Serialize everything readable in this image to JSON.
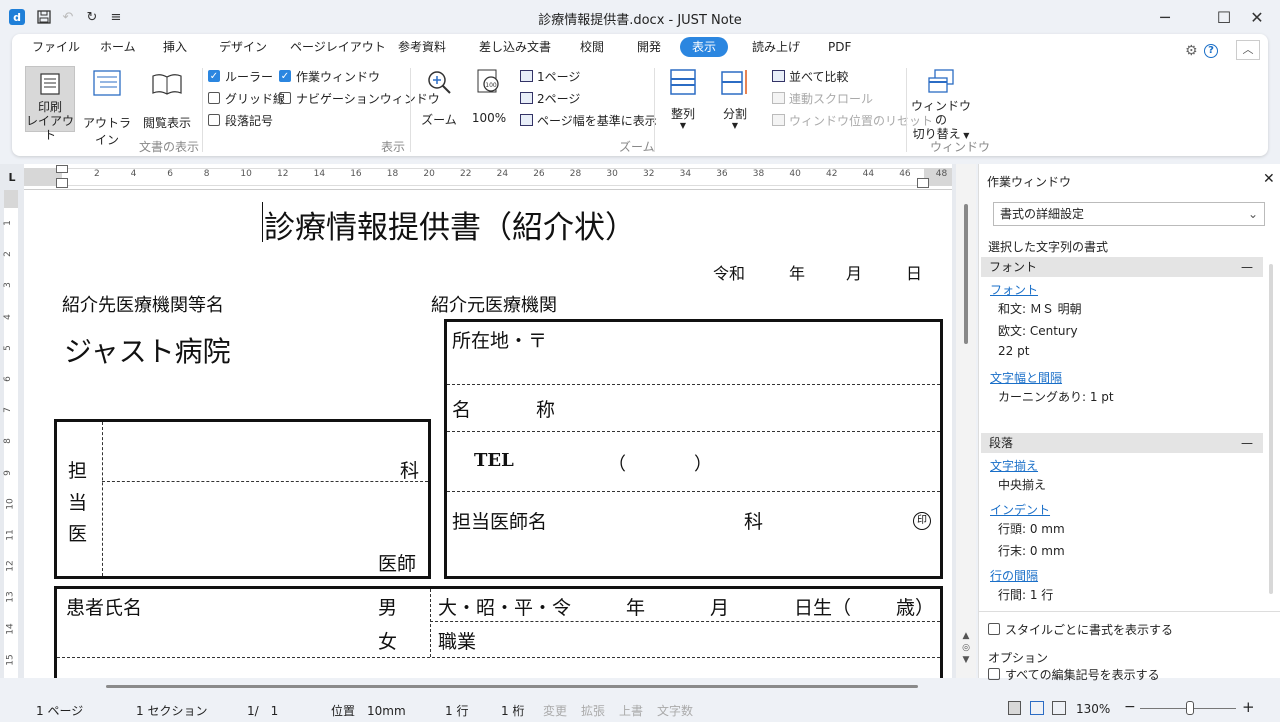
{
  "window": {
    "title": "診療情報提供書.docx - JUST Note",
    "app_icon": "d"
  },
  "ribbon": {
    "tabs": [
      "ファイル",
      "ホーム",
      "挿入",
      "デザイン",
      "ページレイアウト",
      "参考資料",
      "差し込み文書",
      "校閲",
      "開発",
      "表示",
      "読み上げ",
      "PDF"
    ],
    "active_tab": "表示",
    "doc_view": {
      "print_layout": [
        "印刷",
        "レイアウト"
      ],
      "outline": "アウトライン",
      "reading": "閲覧表示",
      "label": "文書の表示"
    },
    "show": {
      "ruler": "ルーラー",
      "gridlines": "グリッド線",
      "paragraph_marks": "段落記号",
      "task_window": "作業ウィンドウ",
      "nav_window": "ナビゲーションウィンドウ",
      "label": "表示"
    },
    "zoom": {
      "zoom": "ズーム",
      "percent": "100%",
      "one_page": "1ページ",
      "two_pages": "2ページ",
      "page_width": "ページ幅を基準に表示",
      "label": "ズーム"
    },
    "window": {
      "arrange": "整列",
      "split": "分割",
      "side_by_side": "並べて比較",
      "sync_scroll": "連動スクロール",
      "reset_pos": "ウィンドウ位置のリセット",
      "switch": [
        "ウィンドウの",
        "切り替え"
      ],
      "label": "ウィンドウ"
    }
  },
  "ruler": {
    "corner": "L",
    "h_ticks": [
      "2",
      "4",
      "6",
      "8",
      "10",
      "12",
      "14",
      "16",
      "18",
      "20",
      "22",
      "24",
      "26",
      "28",
      "30",
      "32",
      "34",
      "36",
      "38",
      "40",
      "42",
      "44",
      "46",
      "48"
    ],
    "v_ticks": [
      "1",
      "2",
      "3",
      "4",
      "5",
      "6",
      "7",
      "8",
      "9",
      "10",
      "11",
      "12",
      "13",
      "14",
      "15"
    ]
  },
  "document": {
    "title": "診療情報提供書（紹介状）",
    "date": {
      "era": "令和",
      "year": "年",
      "month": "月",
      "day": "日"
    },
    "to_label": "紹介先医療機関等名",
    "to_name": "ジャスト病院",
    "from_label": "紹介元医療機関",
    "doctor_box": {
      "c1": "担",
      "c2": "当",
      "c3": "医",
      "dept": "科",
      "doctor": "医師"
    },
    "from_box": {
      "address": "所在地・〒",
      "name_a": "名",
      "name_b": "称",
      "tel": "TEL",
      "paren_open": "（",
      "paren_close": "）",
      "doctor_name": "担当医師名",
      "dept": "科",
      "seal": "印"
    },
    "patient": {
      "name_label": "患者氏名",
      "male": "男",
      "female": "女",
      "birth": "大・昭・平・令",
      "year": "年",
      "month": "月",
      "day": "日生（",
      "age": "歳）",
      "job": "職業"
    }
  },
  "taskpane": {
    "title": "作業ウィンドウ",
    "select": "書式の詳細設定",
    "subtitle": "選択した文字列の書式",
    "font_section": "フォント",
    "font_link": "フォント",
    "font_ja": "和文: ＭＳ 明朝",
    "font_en": "欧文: Century",
    "font_size": "22 pt",
    "spacing_link": "文字幅と間隔",
    "kerning": "カーニングあり: 1 pt",
    "para_section": "段落",
    "align_link": "文字揃え",
    "align_value": "中央揃え",
    "indent_link": "インデント",
    "indent_left": "行頭: 0 mm",
    "indent_right": "行末: 0 mm",
    "linespace_link": "行の間隔",
    "linespace_value": "行間: 1 行",
    "style_check": "スタイルごとに書式を表示する",
    "options": "オプション",
    "marks_check": "すべての編集記号を表示する"
  },
  "status": {
    "page": "1 ページ",
    "section": "1 セクション",
    "pages": "1/　1",
    "position": "位置　10mm",
    "line": "1 行",
    "column": "1 桁",
    "change": "変更",
    "extend": "拡張",
    "overwrite": "上書",
    "wordcount": "文字数",
    "zoom": "130%"
  }
}
